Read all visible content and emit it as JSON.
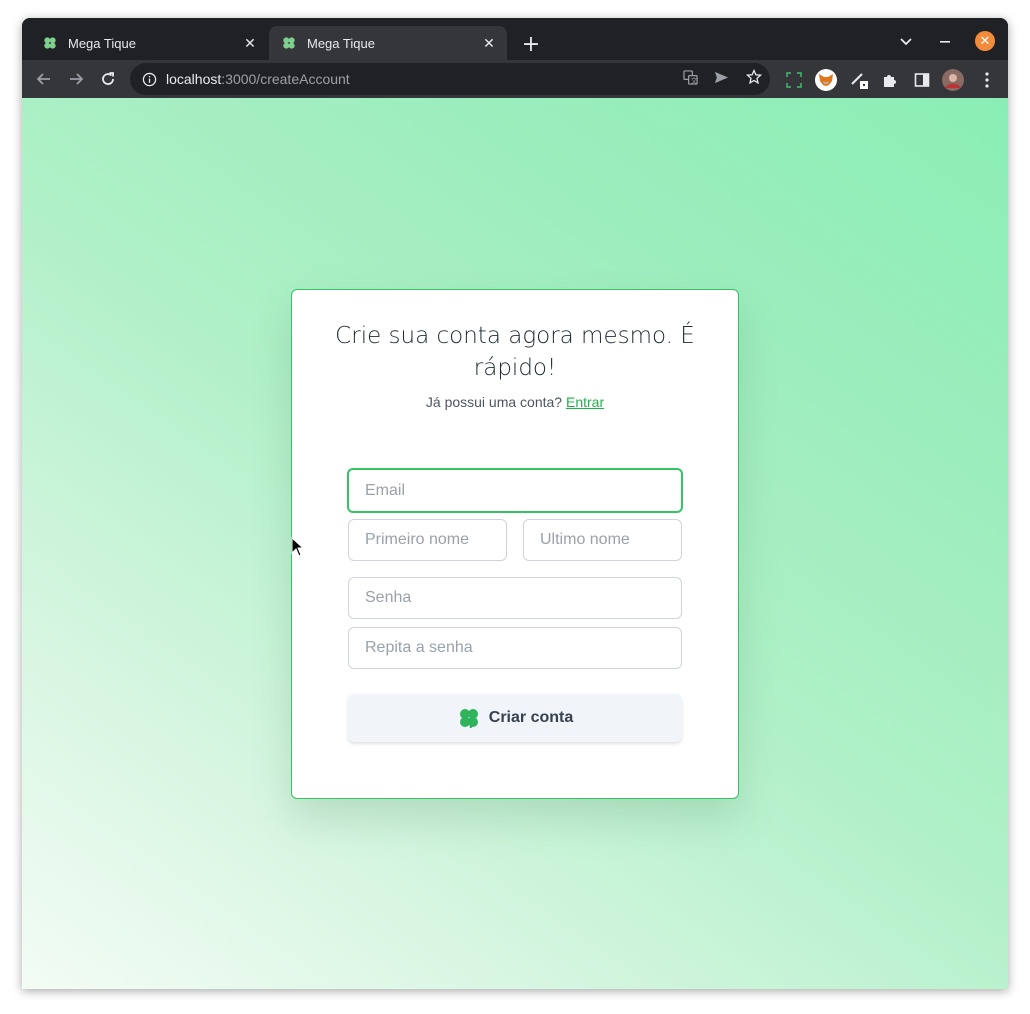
{
  "browser": {
    "tabs": [
      {
        "title": "Mega Tique",
        "active": false
      },
      {
        "title": "Mega Tique",
        "active": true
      }
    ],
    "url_host": "localhost",
    "url_path": ":3000/createAccount"
  },
  "form": {
    "heading": "Crie sua conta agora mesmo. É rápido!",
    "subtitle_text": "Já possui uma conta?",
    "login_link": "Entrar",
    "email_placeholder": "Email",
    "first_name_placeholder": "Primeiro nome",
    "last_name_placeholder": "Ultimo nome",
    "password_placeholder": "Senha",
    "repeat_password_placeholder": "Repita a senha",
    "submit_label": "Criar conta"
  },
  "colors": {
    "accent_green": "#34c463",
    "link_green": "#22b04e",
    "close_orange": "#f28b3b"
  },
  "icons": [
    "clover-icon",
    "back-arrow-icon",
    "forward-arrow-icon",
    "reload-icon",
    "info-icon",
    "translate-icon",
    "send-icon",
    "star-icon",
    "screenshot-icon",
    "metamask-fox-icon",
    "pen-icon",
    "puzzle-extensions-icon",
    "side-panel-icon",
    "profile-avatar",
    "kebab-menu-icon"
  ]
}
